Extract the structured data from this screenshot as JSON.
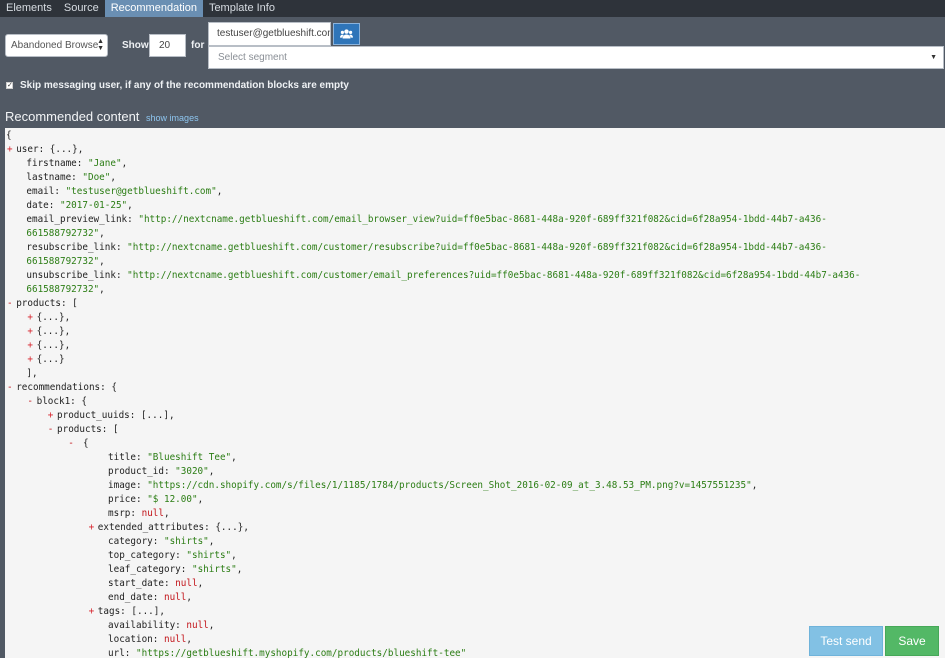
{
  "tabs": [
    "Elements",
    "Source",
    "Recommendation",
    "Template Info"
  ],
  "active_tab": "Recommendation",
  "controls": {
    "type_select": "Abandoned Browse",
    "show_label": "Show",
    "show_count": "20",
    "for_label": "for",
    "user_email": "testuser@getblueshift.com",
    "user_icon": "users-icon",
    "segment_placeholder": "Select segment",
    "skip_checked": true,
    "skip_label": "Skip messaging user, if any of the recommendation blocks are empty"
  },
  "recommended": {
    "title": "Recommended content",
    "show_images": "show images"
  },
  "code_lines": [
    {
      "indent": 0,
      "segs": [
        [
          "k",
          "{"
        ]
      ]
    },
    {
      "indent": 1,
      "toggle": "+",
      "segs": [
        [
          "k",
          "user: {...},"
        ]
      ]
    },
    {
      "indent": 2,
      "segs": [
        [
          "k",
          "firstname: "
        ],
        [
          "s",
          "\"Jane\""
        ],
        [
          "k",
          ","
        ]
      ]
    },
    {
      "indent": 2,
      "segs": [
        [
          "k",
          "lastname: "
        ],
        [
          "s",
          "\"Doe\""
        ],
        [
          "k",
          ","
        ]
      ]
    },
    {
      "indent": 2,
      "segs": [
        [
          "k",
          "email: "
        ],
        [
          "s",
          "\"testuser@getblueshift.com\""
        ],
        [
          "k",
          ","
        ]
      ]
    },
    {
      "indent": 2,
      "segs": [
        [
          "k",
          "date: "
        ],
        [
          "s",
          "\"2017-01-25\""
        ],
        [
          "k",
          ","
        ]
      ]
    },
    {
      "indent": 2,
      "segs": [
        [
          "k",
          "email_preview_link: "
        ],
        [
          "s",
          "\"http://nextcname.getblueshift.com/email_browser_view?uid=ff0e5bac-8681-448a-920f-689ff321f082&cid=6f28a954-1bdd-44b7-a436-"
        ]
      ]
    },
    {
      "indent": 2,
      "segs": [
        [
          "s",
          "661588792732\""
        ],
        [
          "k",
          ","
        ]
      ]
    },
    {
      "indent": 2,
      "segs": [
        [
          "k",
          "resubscribe_link: "
        ],
        [
          "s",
          "\"http://nextcname.getblueshift.com/customer/resubscribe?uid=ff0e5bac-8681-448a-920f-689ff321f082&cid=6f28a954-1bdd-44b7-a436-"
        ]
      ]
    },
    {
      "indent": 2,
      "segs": [
        [
          "s",
          "661588792732\""
        ],
        [
          "k",
          ","
        ]
      ]
    },
    {
      "indent": 2,
      "segs": [
        [
          "k",
          "unsubscribe_link: "
        ],
        [
          "s",
          "\"http://nextcname.getblueshift.com/customer/email_preferences?uid=ff0e5bac-8681-448a-920f-689ff321f082&cid=6f28a954-1bdd-44b7-a436-"
        ]
      ]
    },
    {
      "indent": 2,
      "segs": [
        [
          "s",
          "661588792732\""
        ],
        [
          "k",
          ","
        ]
      ]
    },
    {
      "indent": 1,
      "toggle": "-",
      "segs": [
        [
          "k",
          "products: ["
        ]
      ]
    },
    {
      "indent": 3,
      "toggle": "+",
      "segs": [
        [
          "k",
          "{...},"
        ]
      ]
    },
    {
      "indent": 3,
      "toggle": "+",
      "segs": [
        [
          "k",
          "{...},"
        ]
      ]
    },
    {
      "indent": 3,
      "toggle": "+",
      "segs": [
        [
          "k",
          "{...},"
        ]
      ]
    },
    {
      "indent": 3,
      "toggle": "+",
      "segs": [
        [
          "k",
          "{...}"
        ]
      ]
    },
    {
      "indent": 2,
      "segs": [
        [
          "k",
          "],"
        ]
      ]
    },
    {
      "indent": 1,
      "toggle": "-",
      "segs": [
        [
          "k",
          "recommendations: {"
        ]
      ]
    },
    {
      "indent": 3,
      "toggle": "-",
      "segs": [
        [
          "k",
          "block1: {"
        ]
      ]
    },
    {
      "indent": 5,
      "toggle": "+",
      "segs": [
        [
          "k",
          "product_uuids: [...],"
        ]
      ]
    },
    {
      "indent": 5,
      "toggle": "-",
      "segs": [
        [
          "k",
          "products: ["
        ]
      ]
    },
    {
      "indent": 7,
      "toggle": "-",
      "segs": [
        [
          "k",
          " {"
        ]
      ]
    },
    {
      "indent": 10,
      "segs": [
        [
          "k",
          "title: "
        ],
        [
          "s",
          "\"Blueshift Tee\""
        ],
        [
          "k",
          ","
        ]
      ]
    },
    {
      "indent": 10,
      "segs": [
        [
          "k",
          "product_id: "
        ],
        [
          "s",
          "\"3020\""
        ],
        [
          "k",
          ","
        ]
      ]
    },
    {
      "indent": 10,
      "segs": [
        [
          "k",
          "image: "
        ],
        [
          "s",
          "\"https://cdn.shopify.com/s/files/1/1185/1784/products/Screen_Shot_2016-02-09_at_3.48.53_PM.png?v=1457551235\""
        ],
        [
          "k",
          ","
        ]
      ]
    },
    {
      "indent": 10,
      "segs": [
        [
          "k",
          "price: "
        ],
        [
          "s",
          "\"$ 12.00\""
        ],
        [
          "k",
          ","
        ]
      ]
    },
    {
      "indent": 10,
      "segs": [
        [
          "k",
          "msrp: "
        ],
        [
          "n",
          "null"
        ],
        [
          "k",
          ","
        ]
      ]
    },
    {
      "indent": 9,
      "toggle": "+",
      "segs": [
        [
          "k",
          "extended_attributes: {...},"
        ]
      ]
    },
    {
      "indent": 10,
      "segs": [
        [
          "k",
          "category: "
        ],
        [
          "s",
          "\"shirts\""
        ],
        [
          "k",
          ","
        ]
      ]
    },
    {
      "indent": 10,
      "segs": [
        [
          "k",
          "top_category: "
        ],
        [
          "s",
          "\"shirts\""
        ],
        [
          "k",
          ","
        ]
      ]
    },
    {
      "indent": 10,
      "segs": [
        [
          "k",
          "leaf_category: "
        ],
        [
          "s",
          "\"shirts\""
        ],
        [
          "k",
          ","
        ]
      ]
    },
    {
      "indent": 10,
      "segs": [
        [
          "k",
          "start_date: "
        ],
        [
          "n",
          "null"
        ],
        [
          "k",
          ","
        ]
      ]
    },
    {
      "indent": 10,
      "segs": [
        [
          "k",
          "end_date: "
        ],
        [
          "n",
          "null"
        ],
        [
          "k",
          ","
        ]
      ]
    },
    {
      "indent": 9,
      "toggle": "+",
      "segs": [
        [
          "k",
          "tags: [...],"
        ]
      ]
    },
    {
      "indent": 10,
      "segs": [
        [
          "k",
          "availability: "
        ],
        [
          "n",
          "null"
        ],
        [
          "k",
          ","
        ]
      ]
    },
    {
      "indent": 10,
      "segs": [
        [
          "k",
          "location: "
        ],
        [
          "n",
          "null"
        ],
        [
          "k",
          ","
        ]
      ]
    },
    {
      "indent": 10,
      "segs": [
        [
          "k",
          "url: "
        ],
        [
          "s",
          "\"https://getblueshift.myshopify.com/products/blueshift-tee\""
        ]
      ]
    }
  ],
  "buttons": {
    "test_send": "Test send",
    "save": "Save"
  }
}
